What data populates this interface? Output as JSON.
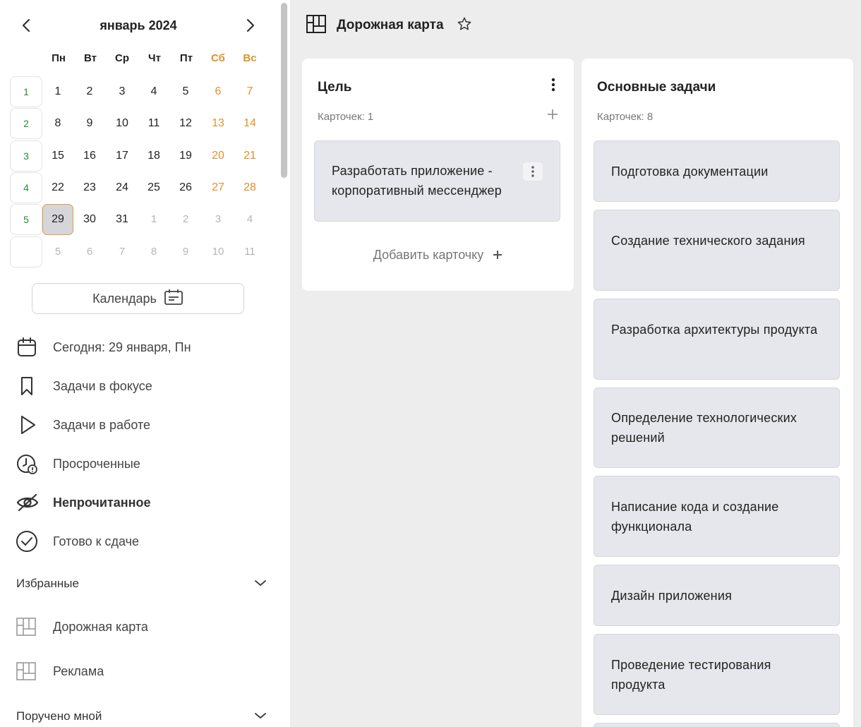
{
  "calendar": {
    "title": "январь 2024",
    "weekdays": [
      "Пн",
      "Вт",
      "Ср",
      "Чт",
      "Пт",
      "Сб",
      "Вс"
    ],
    "week_numbers": [
      "1",
      "2",
      "3",
      "4",
      "5",
      ""
    ],
    "rows": [
      [
        "1",
        "2",
        "3",
        "4",
        "5",
        "6",
        "7"
      ],
      [
        "8",
        "9",
        "10",
        "11",
        "12",
        "13",
        "14"
      ],
      [
        "15",
        "16",
        "17",
        "18",
        "19",
        "20",
        "21"
      ],
      [
        "22",
        "23",
        "24",
        "25",
        "26",
        "27",
        "28"
      ],
      [
        "29",
        "30",
        "31",
        "1",
        "2",
        "3",
        "4"
      ],
      [
        "5",
        "6",
        "7",
        "8",
        "9",
        "10",
        "11"
      ]
    ],
    "selected_day": "29",
    "button_label": "Календарь"
  },
  "nav": {
    "today": "Сегодня: 29 января, Пн",
    "focus": "Задачи в фокусе",
    "in_progress": "Задачи в работе",
    "overdue": "Просроченные",
    "unread": "Непрочитанное",
    "ready": "Готово к сдаче"
  },
  "favorites": {
    "title": "Избранные",
    "items": [
      "Дорожная карта",
      "Реклама"
    ]
  },
  "assigned": {
    "title": "Поручено мной"
  },
  "board": {
    "title": "Дорожная карта",
    "columns": [
      {
        "title": "Цель",
        "count": "Карточек: 1",
        "cards": [
          "Разработать приложение - корпоративный мессенджер"
        ],
        "add_label": "Добавить карточку"
      },
      {
        "title": "Основные задачи",
        "count": "Карточек: 8",
        "cards": [
          "Подготовка документации",
          "Создание технического задания",
          "Разработка архитектуры продукта",
          "Определение технологических решений",
          "Написание кода и создание функционала",
          "Дизайн приложения",
          "Проведение тестирования продукта"
        ]
      }
    ]
  },
  "colors": {
    "weekend": "#e0922a",
    "week_number": "#2a8a3a",
    "board_bg": "#ededee",
    "card_bg": "#e6e7ec"
  }
}
